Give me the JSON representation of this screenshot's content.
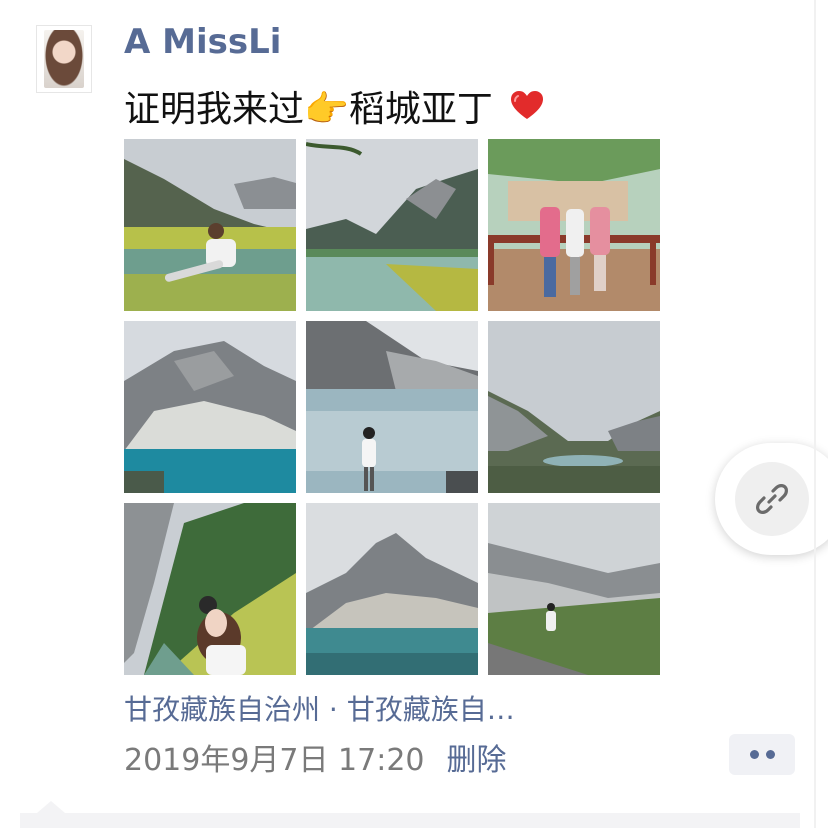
{
  "post": {
    "username": "A MissLi",
    "text": "证明我来过👉稻城亚丁",
    "location": "甘孜藏族自治州 · 甘孜藏族自…",
    "timestamp": "2019年9月7日 17:20",
    "delete_label": "删除"
  },
  "icons": {
    "heart": "heart-icon",
    "link": "link-icon",
    "more": "more-dots-icon"
  },
  "colors": {
    "link_blue": "#576b95",
    "heart_red": "#e22b2b",
    "timestamp_gray": "#7a7a7a"
  }
}
